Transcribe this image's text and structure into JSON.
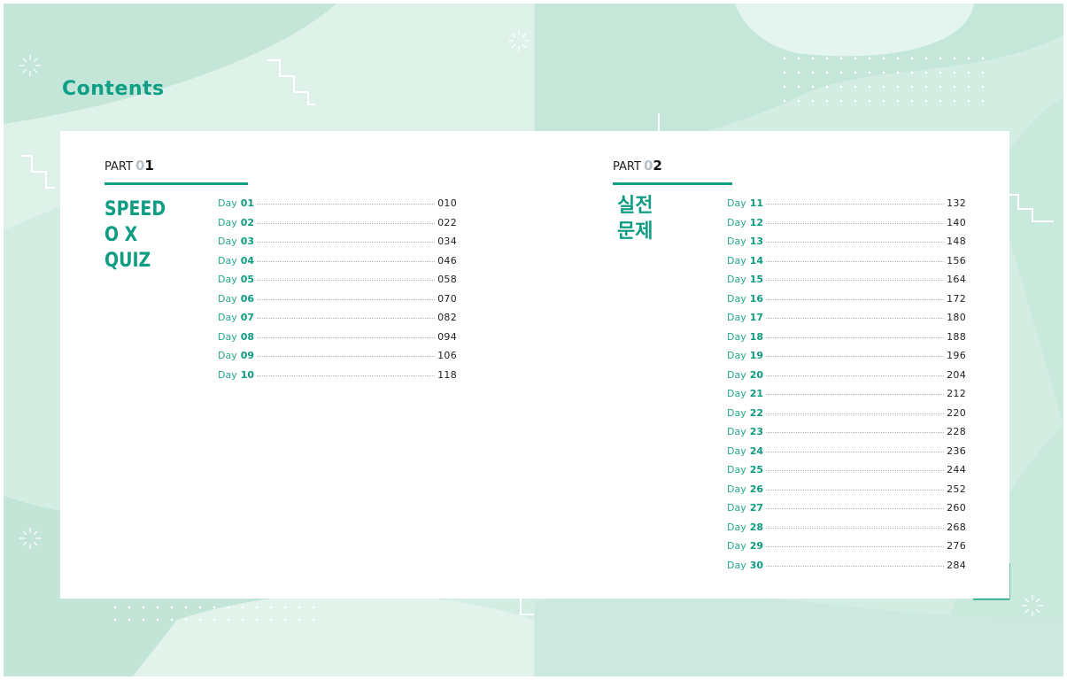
{
  "title": "Contents",
  "colors": {
    "accent": "#0f9f86",
    "background": "#d3ede3"
  },
  "parts": [
    {
      "label": "PART",
      "number_lead": "0",
      "number": "1",
      "title_lines": [
        "SPEED",
        "O X",
        "QUIZ"
      ],
      "entries": [
        {
          "label": "Day",
          "day": "01",
          "page": "010"
        },
        {
          "label": "Day",
          "day": "02",
          "page": "022"
        },
        {
          "label": "Day",
          "day": "03",
          "page": "034"
        },
        {
          "label": "Day",
          "day": "04",
          "page": "046"
        },
        {
          "label": "Day",
          "day": "05",
          "page": "058"
        },
        {
          "label": "Day",
          "day": "06",
          "page": "070"
        },
        {
          "label": "Day",
          "day": "07",
          "page": "082"
        },
        {
          "label": "Day",
          "day": "08",
          "page": "094"
        },
        {
          "label": "Day",
          "day": "09",
          "page": "106"
        },
        {
          "label": "Day",
          "day": "10",
          "page": "118"
        }
      ]
    },
    {
      "label": "PART",
      "number_lead": "0",
      "number": "2",
      "title_lines": [
        "실전",
        "문제"
      ],
      "entries": [
        {
          "label": "Day",
          "day": "11",
          "page": "132"
        },
        {
          "label": "Day",
          "day": "12",
          "page": "140"
        },
        {
          "label": "Day",
          "day": "13",
          "page": "148"
        },
        {
          "label": "Day",
          "day": "14",
          "page": "156"
        },
        {
          "label": "Day",
          "day": "15",
          "page": "164"
        },
        {
          "label": "Day",
          "day": "16",
          "page": "172"
        },
        {
          "label": "Day",
          "day": "17",
          "page": "180"
        },
        {
          "label": "Day",
          "day": "18",
          "page": "188"
        },
        {
          "label": "Day",
          "day": "19",
          "page": "196"
        },
        {
          "label": "Day",
          "day": "20",
          "page": "204"
        },
        {
          "label": "Day",
          "day": "21",
          "page": "212"
        },
        {
          "label": "Day",
          "day": "22",
          "page": "220"
        },
        {
          "label": "Day",
          "day": "23",
          "page": "228"
        },
        {
          "label": "Day",
          "day": "24",
          "page": "236"
        },
        {
          "label": "Day",
          "day": "25",
          "page": "244"
        },
        {
          "label": "Day",
          "day": "26",
          "page": "252"
        },
        {
          "label": "Day",
          "day": "27",
          "page": "260"
        },
        {
          "label": "Day",
          "day": "28",
          "page": "268"
        },
        {
          "label": "Day",
          "day": "29",
          "page": "276"
        },
        {
          "label": "Day",
          "day": "30",
          "page": "284"
        }
      ]
    }
  ]
}
